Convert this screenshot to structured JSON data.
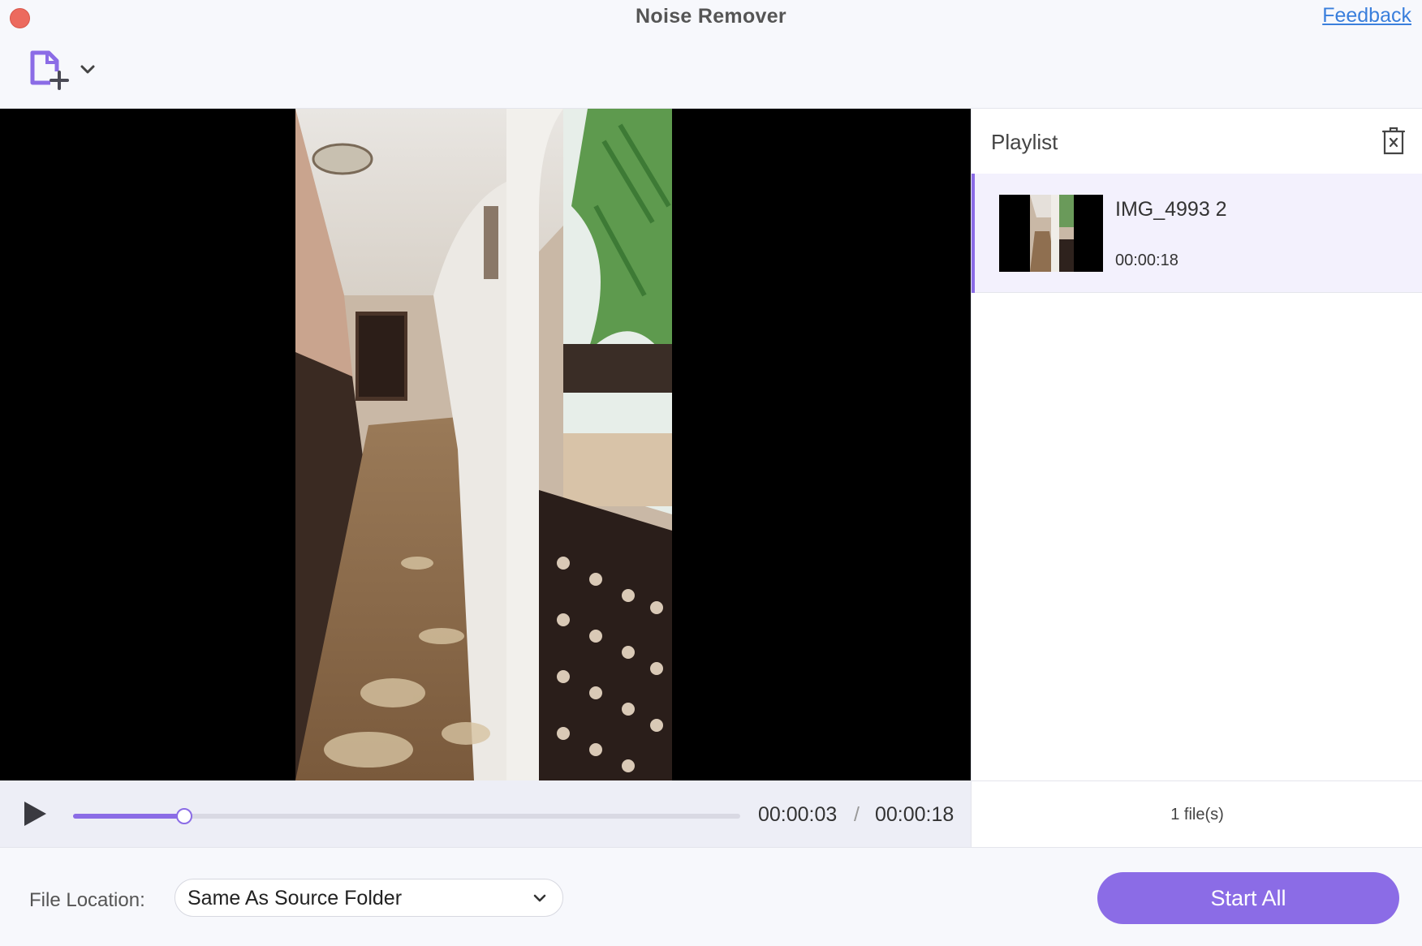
{
  "app": {
    "title": "Noise Remover",
    "feedback_label": "Feedback",
    "accent_color": "#8b6ce6"
  },
  "toolbar": {
    "add_file_icon": "add-file-icon",
    "dropdown_icon": "chevron-down-icon"
  },
  "player": {
    "current_time": "00:00:03",
    "time_separator": "/",
    "total_time": "00:00:18",
    "progress_fraction": 0.1667,
    "play_icon": "play-icon"
  },
  "playlist": {
    "title": "Playlist",
    "clear_icon": "trash-icon",
    "items": [
      {
        "name": "IMG_4993 2",
        "duration": "00:00:18"
      }
    ],
    "file_count": "1 file(s)"
  },
  "output": {
    "location_label": "File Location:",
    "location_value": "Same As Source Folder",
    "start_label": "Start All"
  }
}
